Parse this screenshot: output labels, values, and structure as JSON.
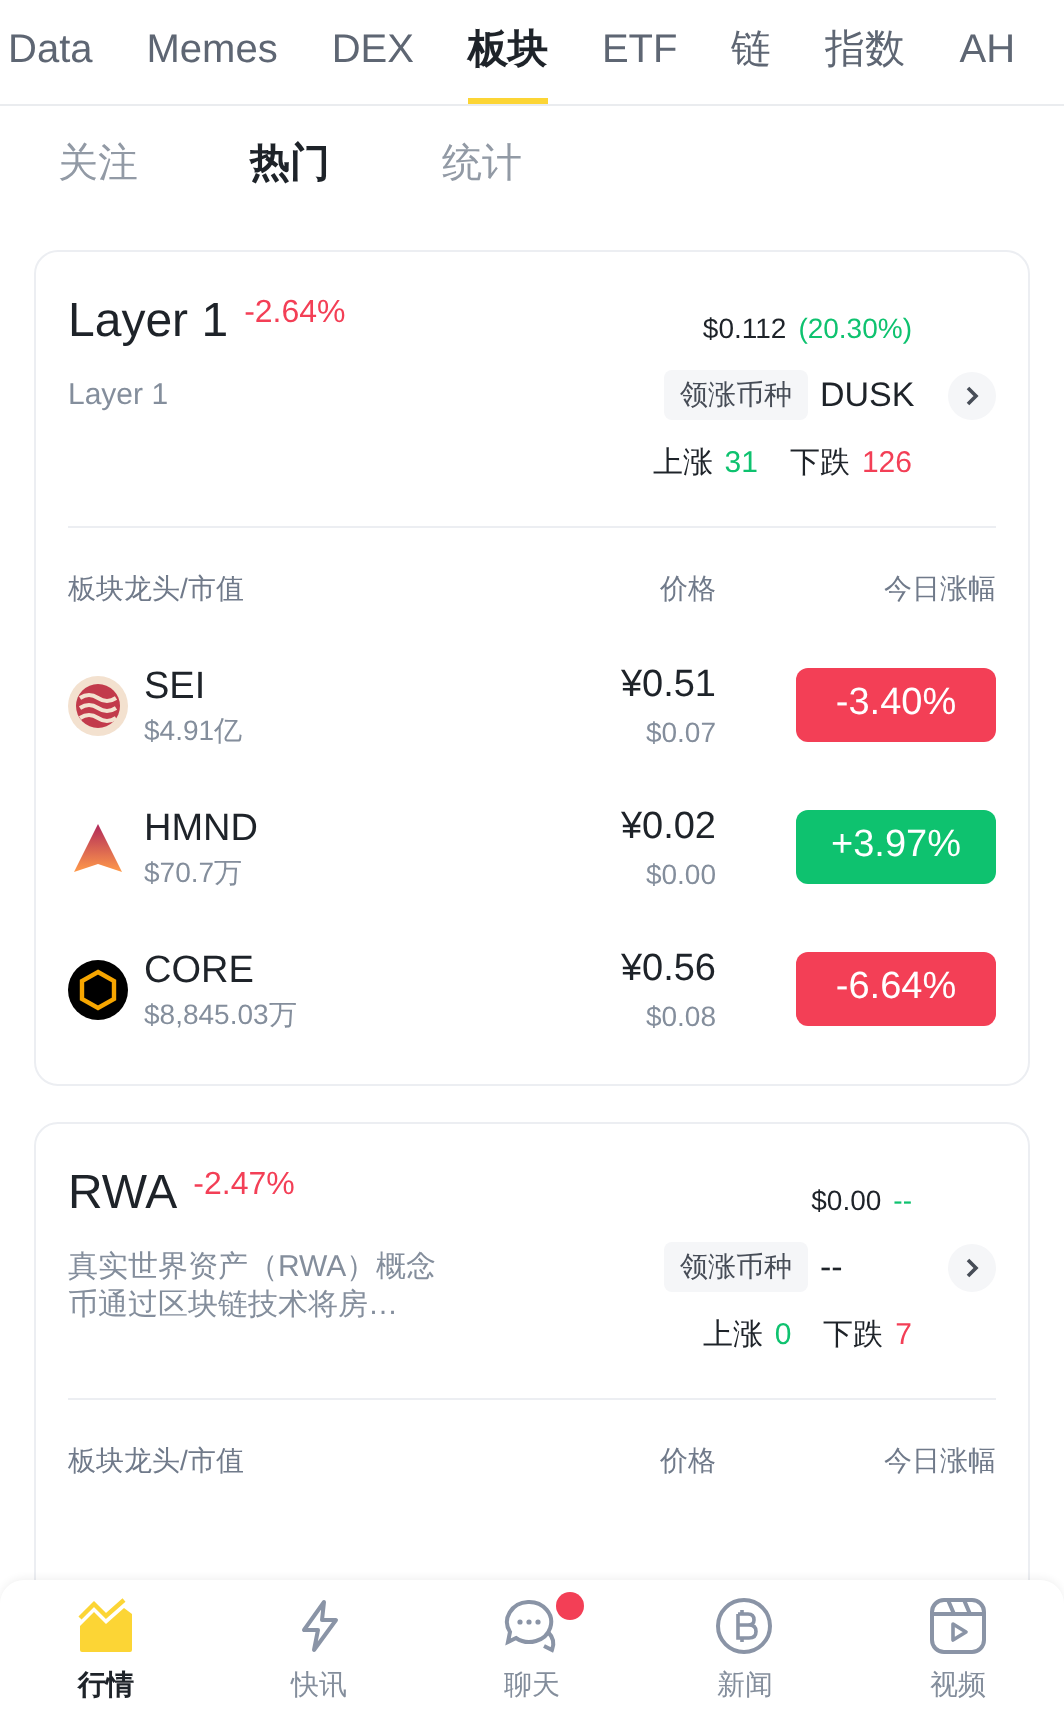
{
  "top_tabs": [
    {
      "label": "Data",
      "selected": false
    },
    {
      "label": "Memes",
      "selected": false
    },
    {
      "label": "DEX",
      "selected": false
    },
    {
      "label": "板块",
      "selected": true
    },
    {
      "label": "ETF",
      "selected": false
    },
    {
      "label": "链",
      "selected": false
    },
    {
      "label": "指数",
      "selected": false
    },
    {
      "label": "AH",
      "selected": false
    }
  ],
  "sub_tabs": [
    {
      "label": "关注",
      "selected": false
    },
    {
      "label": "热门",
      "selected": true
    },
    {
      "label": "统计",
      "selected": false
    }
  ],
  "sectors": [
    {
      "name": "Layer 1",
      "change": "-2.64%",
      "description": "Layer 1",
      "leader_price": "$0.112",
      "leader_change": "(20.30%)",
      "leader_label": "领涨币种",
      "leader_symbol": "DUSK",
      "up_label": "上涨",
      "up_count": "31",
      "down_label": "下跌",
      "down_count": "126",
      "columns": [
        "板块龙头/市值",
        "价格",
        "今日涨幅"
      ],
      "rows": [
        {
          "symbol": "SEI",
          "market_cap": "$4.91亿",
          "price": "¥0.51",
          "price_usd": "$0.07",
          "change": "-3.40%",
          "color": "#f33f56"
        },
        {
          "symbol": "HMND",
          "market_cap": "$70.7万",
          "price": "¥0.02",
          "price_usd": "$0.00",
          "change": "+3.97%",
          "color": "#0ec26f"
        },
        {
          "symbol": "CORE",
          "market_cap": "$8,845.03万",
          "price": "¥0.56",
          "price_usd": "$0.08",
          "change": "-6.64%",
          "color": "#f33f56"
        }
      ]
    },
    {
      "name": "RWA",
      "change": "-2.47%",
      "description": "真实世界资产（RWA）概念币通过区块链技术将房…",
      "leader_price": "$0.00",
      "leader_change": "--",
      "leader_label": "领涨币种",
      "leader_symbol": "--",
      "up_label": "上涨",
      "up_count": "0",
      "down_label": "下跌",
      "down_count": "7",
      "columns": [
        "板块龙头/市值",
        "价格",
        "今日涨幅"
      ]
    }
  ],
  "bottom_nav": [
    {
      "label": "行情",
      "selected": true,
      "dot": false
    },
    {
      "label": "快讯",
      "selected": false,
      "dot": false
    },
    {
      "label": "聊天",
      "selected": false,
      "dot": true
    },
    {
      "label": "新闻",
      "selected": false,
      "dot": false
    },
    {
      "label": "视频",
      "selected": false,
      "dot": false
    }
  ]
}
